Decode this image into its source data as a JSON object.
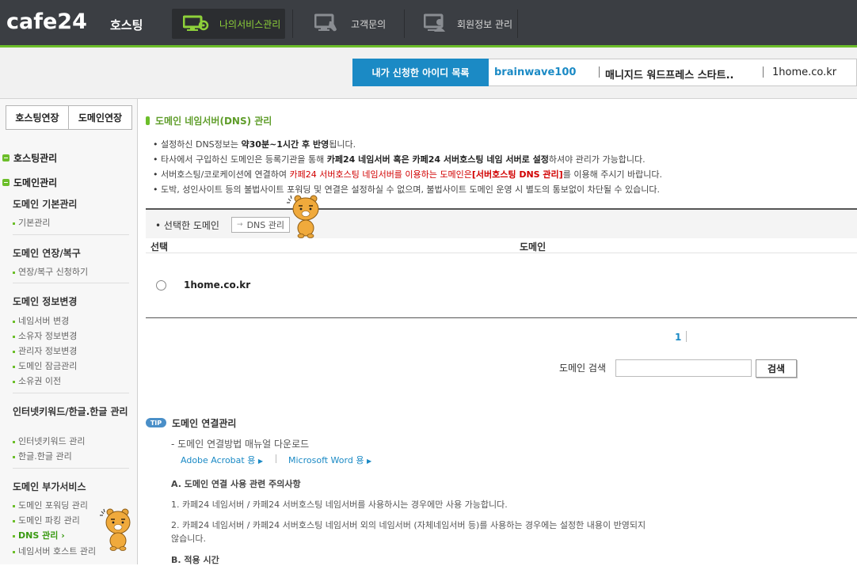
{
  "header": {
    "logo": "cafe24",
    "logo_sub": "호스팅",
    "nav": [
      {
        "label": "나의서비스관리",
        "active": true,
        "icon": "service-manage-icon"
      },
      {
        "label": "고객문의",
        "active": false,
        "icon": "customer-support-icon"
      },
      {
        "label": "회원정보 관리",
        "active": false,
        "icon": "member-info-icon"
      }
    ]
  },
  "account": {
    "label": "내가 신청한 아이디 목록",
    "id": "brainwave100",
    "plan": "매니지드 워드프레스 스타트..",
    "domain": "1home.co.kr"
  },
  "sidebar": {
    "tabs": [
      "호스팅연장",
      "도메인연장"
    ],
    "sections": [
      "호스팅관리",
      "도메인관리"
    ],
    "groups": [
      {
        "title": "도메인 기본관리",
        "links": [
          "기본관리"
        ]
      },
      {
        "title": "도메인 연장/복구",
        "links": [
          "연장/복구 신청하기"
        ]
      },
      {
        "title": "도메인 정보변경",
        "links": [
          "네임서버 변경",
          "소유자 정보변경",
          "관리자 정보변경",
          "도메인 잠금관리",
          "소유권 이전"
        ]
      },
      {
        "title": "인터넷키워드/한글.한글 관리",
        "links": [
          "인터넷키워드 관리",
          "한글.한글 관리"
        ]
      },
      {
        "title": "도메인 부가서비스",
        "links": [
          "도메인 포워딩 관리",
          "도메인 파킹 관리",
          "DNS 관리",
          "네임서버 호스트 관리"
        ]
      }
    ],
    "active_link": "DNS 관리"
  },
  "main": {
    "title": "도메인 네임서버(DNS) 관리",
    "notices": [
      {
        "pre": "설정하신 DNS정보는 ",
        "bold": "약30분~1시간 후 반영",
        "post": "됩니다."
      },
      {
        "pre": "타사에서 구입하신 도메인은 등록기관을 통해 ",
        "bold": "카페24 네임서버 혹은 카페24 서버호스팅 네임 서버로 설정",
        "post": "하셔야 관리가 가능합니다."
      },
      {
        "pre": "서버호스팅/코로케이션에 연결하여 ",
        "red": "카페24 서버호스팅 네임서버를 이용하는 도메인은",
        "redbold": "[서버호스팅 DNS 관리]",
        "post": "를 이용해 주시기 바랍니다."
      },
      {
        "pre": "도박, 성인사이트 등의 불법사이트 포워딩 및 연결은 설정하실 수 없으며, 불법사이트 도메인 운영 시 별도의 통보없이 차단될 수 있습니다."
      }
    ],
    "selected_label": "선택한 도메인",
    "dns_button": "DNS 관리",
    "columns": [
      "선택",
      "도메인"
    ],
    "rows": [
      {
        "domain": "1home.co.kr"
      }
    ],
    "page": "1",
    "search_label": "도메인 검색",
    "search_value": "",
    "search_button": "검색",
    "tip": {
      "badge": "TIP",
      "title": "도메인 연결관리",
      "manual": "- 도메인 연결방법 매뉴얼 다운로드",
      "links": [
        "Adobe Acrobat 용",
        "Microsoft Word 용"
      ],
      "section_a": "A. 도메인 연결 사용 관련 주의사항",
      "item1": "1. 카페24 네임서버 / 카페24 서버호스팅 네임서버를 사용하시는 경우에만 사용 가능합니다.",
      "item2": "2. 카페24 네임서버 / 카페24 서버호스팅 네임서버 외의 네임서버 (자체네임서버 등)를 사용하는 경우에는 설정한 내용이 반영되지 않습니다.",
      "section_b": "B. 적용 시간"
    }
  },
  "colors": {
    "header": "#3b3e43",
    "accent_green": "#6cbe2a",
    "accent_blue": "#1b8ac5"
  }
}
